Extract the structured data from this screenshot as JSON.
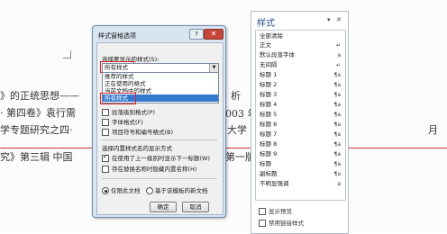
{
  "document": {
    "lines": [
      "》的正统思想——",
      "· 第四卷》袁行需",
      "学专题研究之四·",
      "究》第三辑   中国",
      "析",
      "003 年",
      "大学",
      "第一版",
      "月"
    ]
  },
  "dialog": {
    "title": "样式窗格选项",
    "help_label": "?",
    "close_label": "✕",
    "select_label": "选择要显示的样式(S):",
    "combo_value": "所有样式",
    "options": [
      "推荐的样式",
      "正在使用的格式",
      "当前文档中的样式",
      "所有样式"
    ],
    "selected_option": "所有样式",
    "checkboxes": [
      {
        "label": "段落级别格式(P)",
        "checked": false
      },
      {
        "label": "字体格式(F)",
        "checked": false
      },
      {
        "label": "项目符号和编号格式(B)",
        "checked": false
      }
    ],
    "display_section_label": "选择内置样式名的显示方式",
    "builtin_options": [
      {
        "label": "在使用了上一级别时显示下一标题(W)",
        "checked": true
      },
      {
        "label": "存在替换名称时隐藏内置名称(H)",
        "checked": false
      }
    ],
    "scope_options": [
      {
        "label": "仅限此文档",
        "selected": true
      },
      {
        "label": "基于该模板的新文档",
        "selected": false
      }
    ],
    "ok_label": "确定",
    "cancel_label": "取消"
  },
  "styles_pane": {
    "title": "样式",
    "controls": [
      "▾",
      "✕"
    ],
    "items": [
      {
        "label": "全部清除",
        "mark": ""
      },
      {
        "label": "正文",
        "mark": "↵"
      },
      {
        "label": "默认段落字体",
        "mark": "a"
      },
      {
        "label": "无间隔",
        "mark": "↵"
      },
      {
        "label": "标题 1",
        "mark": "¶a"
      },
      {
        "label": "标题 2",
        "mark": "¶a"
      },
      {
        "label": "标题 3",
        "mark": "¶a"
      },
      {
        "label": "标题 4",
        "mark": "¶a"
      },
      {
        "label": "标题 5",
        "mark": "¶a"
      },
      {
        "label": "标题 6",
        "mark": "¶a"
      },
      {
        "label": "标题 7",
        "mark": "¶a"
      },
      {
        "label": "标题 8",
        "mark": "¶a"
      },
      {
        "label": "标题 9",
        "mark": "¶a"
      },
      {
        "label": "标题",
        "mark": "¶a"
      },
      {
        "label": "副标题",
        "mark": "¶a"
      },
      {
        "label": "不明显强调",
        "mark": "a"
      }
    ],
    "footer": [
      {
        "label": "显示预览",
        "checked": false
      },
      {
        "label": "禁用链接样式",
        "checked": false
      }
    ]
  },
  "colors": {
    "highlight": "#3478d0",
    "annotation_red": "#d9242c",
    "dialog_frame": "#d9e4f2"
  }
}
